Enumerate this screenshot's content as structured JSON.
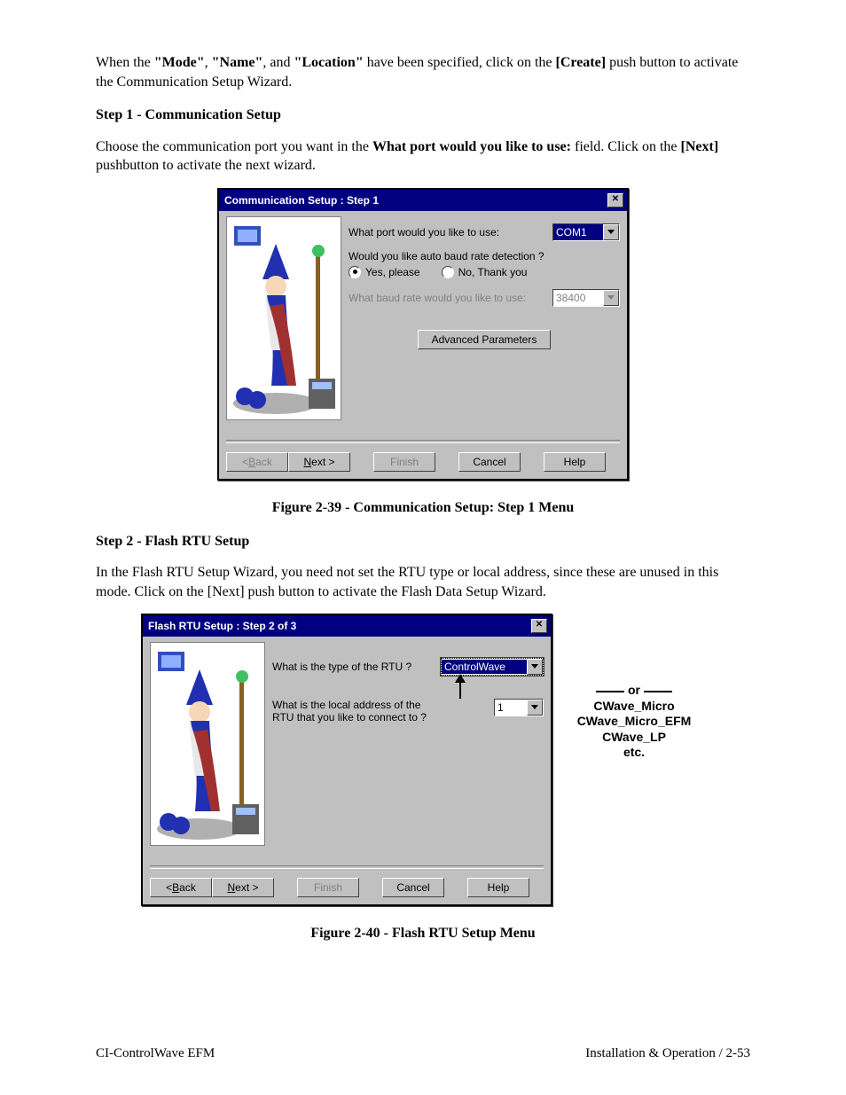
{
  "para1_prefix": "When the ",
  "para1_mode": "\"Mode\"",
  "para1_sep1": ", ",
  "para1_name": "\"Name\"",
  "para1_sep2": ", and ",
  "para1_location": "\"Location\"",
  "para1_mid": " have been specified, click on the ",
  "para1_create": "[Create]",
  "para1_suffix": " push button to activate the Communication Setup Wizard.",
  "step1_head": "Step 1 - Communication Setup",
  "para2_prefix": "Choose the communication port you want in the ",
  "para2_bold": "What port would you like to use:",
  "para2_mid": " field. Click on the ",
  "para2_next": "[Next]",
  "para2_suffix": " pushbutton to activate the next wizard.",
  "fig1_caption": "Figure 2-39 - Communication Setup: Step 1 Menu",
  "step2_head": "Step 2 - Flash RTU Setup",
  "para3": "In the Flash RTU Setup Wizard, you need not set the RTU type or local address, since these are unused in this mode. Click on the [Next] push button to activate the Flash Data Setup Wizard.",
  "fig2_caption": "Figure 2-40 - Flash RTU Setup Menu",
  "footer_left": "CI-ControlWave EFM",
  "footer_right": "Installation & Operation / 2-53",
  "dlg1": {
    "title": "Communication Setup : Step 1",
    "q_port": "What port would you like to use:",
    "port_value": "COM1",
    "q_autobaud": "Would you like auto baud rate detection ?",
    "radio_yes": "Yes, please",
    "radio_no": "No, Thank you",
    "q_baud": "What baud rate would you like to use:",
    "baud_value": "38400",
    "advanced": "Advanced Parameters",
    "back_pre": "< ",
    "back_u": "B",
    "back_post": "ack",
    "next_u": "N",
    "next_post": "ext >",
    "finish": "Finish",
    "cancel": "Cancel",
    "help": "Help"
  },
  "dlg2": {
    "title": "Flash RTU Setup : Step 2 of 3",
    "q_type": "What is the type of the RTU ?",
    "type_value": "ControlWave",
    "q_addr1": "What is the local address of the",
    "q_addr2": "RTU that you like to connect to ?",
    "addr_value": "1",
    "back_pre": "< ",
    "back_u": "B",
    "back_post": "ack",
    "next_u": "N",
    "next_post": "ext >",
    "finish": "Finish",
    "cancel": "Cancel",
    "help": "Help"
  },
  "annot": {
    "or": "or",
    "l1": "CWave_Micro",
    "l2": "CWave_Micro_EFM",
    "l3": "CWave_LP",
    "l4": "etc."
  }
}
